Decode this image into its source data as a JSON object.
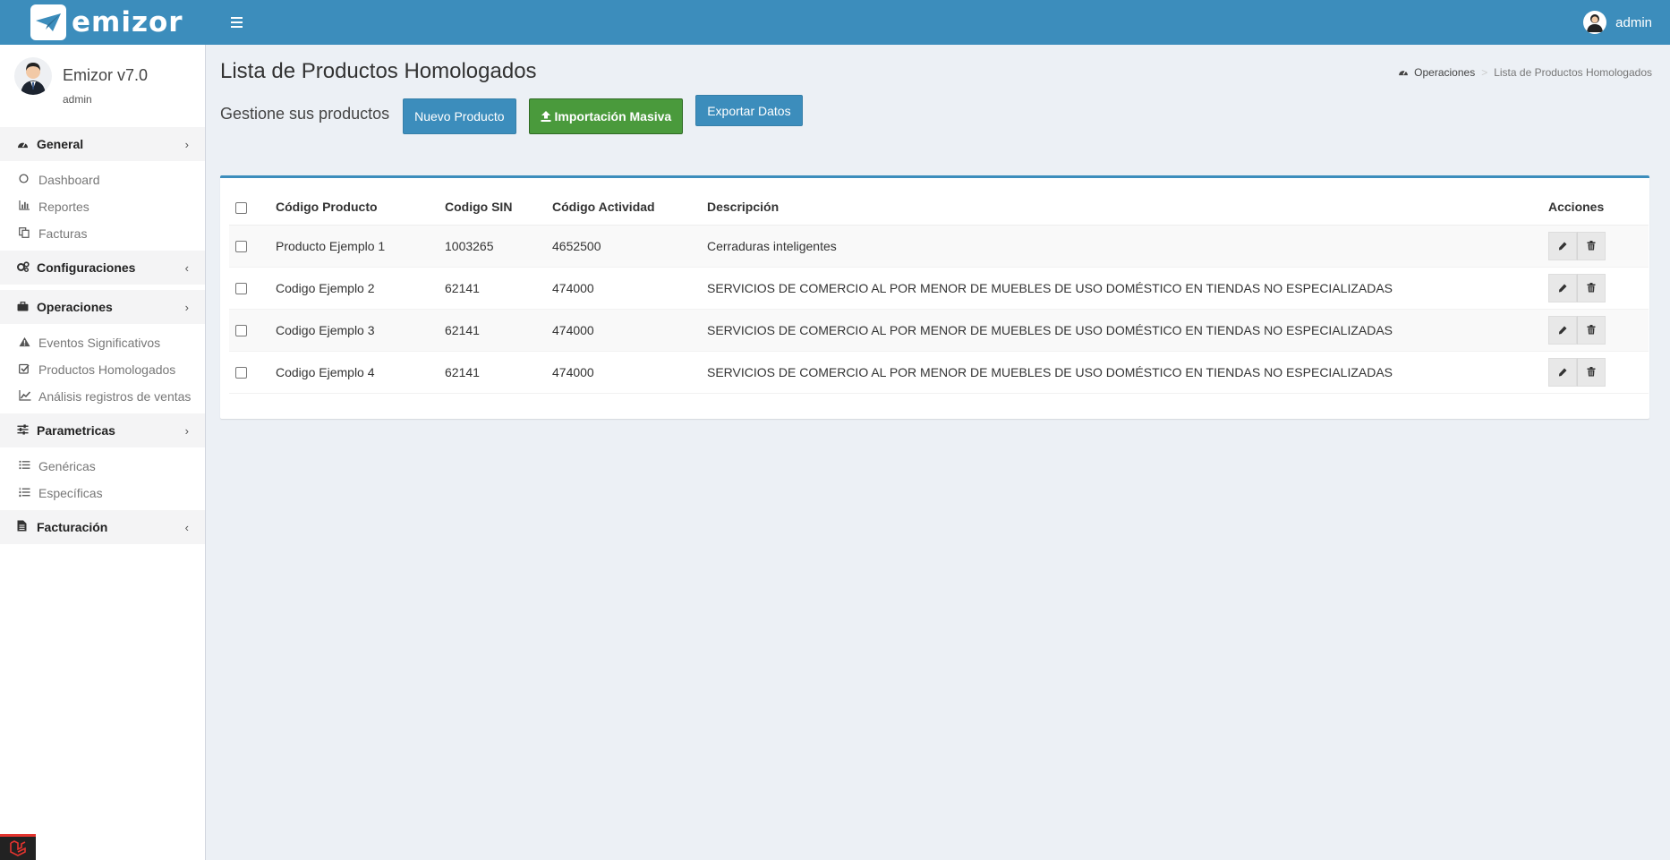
{
  "header": {
    "brand": "emizor",
    "user": "admin"
  },
  "sidebar": {
    "profile": {
      "name": "Emizor v7.0",
      "role": "admin"
    },
    "groups": [
      {
        "label": "General",
        "icon": "dashboard-icon",
        "expanded": true,
        "items": [
          {
            "label": "Dashboard",
            "icon": "circle-icon"
          },
          {
            "label": "Reportes",
            "icon": "bar-chart-icon"
          },
          {
            "label": "Facturas",
            "icon": "copy-icon"
          }
        ]
      },
      {
        "label": "Configuraciones",
        "icon": "gears-icon",
        "expanded": false,
        "items": []
      },
      {
        "label": "Operaciones",
        "icon": "briefcase-icon",
        "expanded": true,
        "items": [
          {
            "label": "Eventos Significativos",
            "icon": "warning-icon"
          },
          {
            "label": "Productos Homologados",
            "icon": "check-square-icon"
          },
          {
            "label": "Análisis registros de ventas",
            "icon": "line-chart-icon"
          }
        ]
      },
      {
        "label": "Parametricas",
        "icon": "sliders-icon",
        "expanded": true,
        "items": [
          {
            "label": "Genéricas",
            "icon": "list-icon"
          },
          {
            "label": "Específicas",
            "icon": "list-ol-icon"
          }
        ]
      },
      {
        "label": "Facturación",
        "icon": "file-text-icon",
        "expanded": false,
        "items": []
      }
    ]
  },
  "page": {
    "title": "Lista de Productos Homologados",
    "breadcrumb": [
      "Operaciones",
      "Lista de Productos Homologados"
    ],
    "subtitle": "Gestione sus productos",
    "buttons": {
      "new": "Nuevo Producto",
      "import": "Importación Masiva",
      "export": "Exportar Datos"
    }
  },
  "table": {
    "headers": [
      "Código Producto",
      "Codigo SIN",
      "Código Actividad",
      "Descripción",
      "Acciones"
    ],
    "rows": [
      [
        "Producto Ejemplo 1",
        "1003265",
        "4652500",
        "Cerraduras inteligentes"
      ],
      [
        "Codigo Ejemplo 2",
        "62141",
        "474000",
        "SERVICIOS DE COMERCIO AL POR MENOR DE MUEBLES DE USO DOMÉSTICO EN TIENDAS NO ESPECIALIZADAS"
      ],
      [
        "Codigo Ejemplo 3",
        "62141",
        "474000",
        "SERVICIOS DE COMERCIO AL POR MENOR DE MUEBLES DE USO DOMÉSTICO EN TIENDAS NO ESPECIALIZADAS"
      ],
      [
        "Codigo Ejemplo 4",
        "62141",
        "474000",
        "SERVICIOS DE COMERCIO AL POR MENOR DE MUEBLES DE USO DOMÉSTICO EN TIENDAS NO ESPECIALIZADAS"
      ]
    ]
  },
  "colors": {
    "primary": "#3c8dbc",
    "success": "#4a9a3c",
    "sidebar_bg": "#ffffff",
    "content_bg": "#ecf0f5"
  }
}
